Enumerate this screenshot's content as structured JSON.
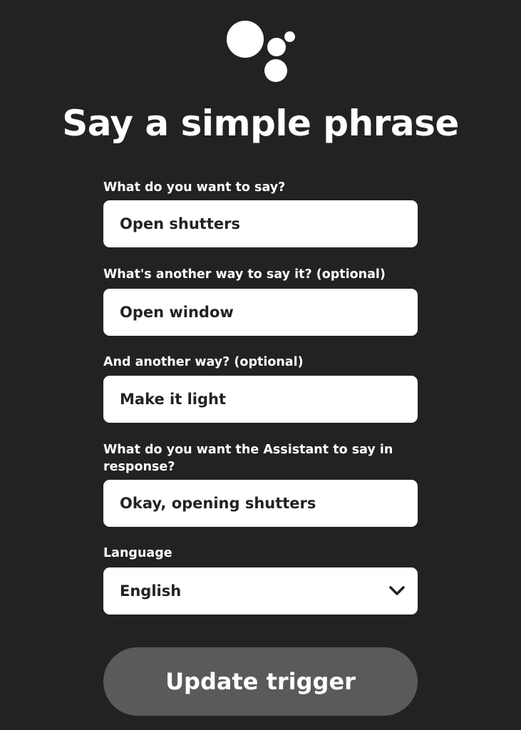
{
  "header": {
    "logo_icon": "google-assistant-dots-icon",
    "title": "Say a simple phrase"
  },
  "form": {
    "phrase": {
      "label": "What do you want to say?",
      "value": "Open shutters"
    },
    "alt_phrase_1": {
      "label": "What's another way to say it? (optional)",
      "value": "Open window"
    },
    "alt_phrase_2": {
      "label": "And another way? (optional)",
      "value": "Make it light"
    },
    "response": {
      "label": "What do you want the Assistant to say in response?",
      "value": "Okay, opening shutters"
    },
    "language": {
      "label": "Language",
      "value": "English",
      "icon": "chevron-down-icon"
    }
  },
  "actions": {
    "submit_label": "Update trigger"
  },
  "colors": {
    "background": "#222222",
    "field_background": "#ffffff",
    "field_text": "#222222",
    "button_background": "#5a5a5a",
    "text": "#ffffff"
  }
}
